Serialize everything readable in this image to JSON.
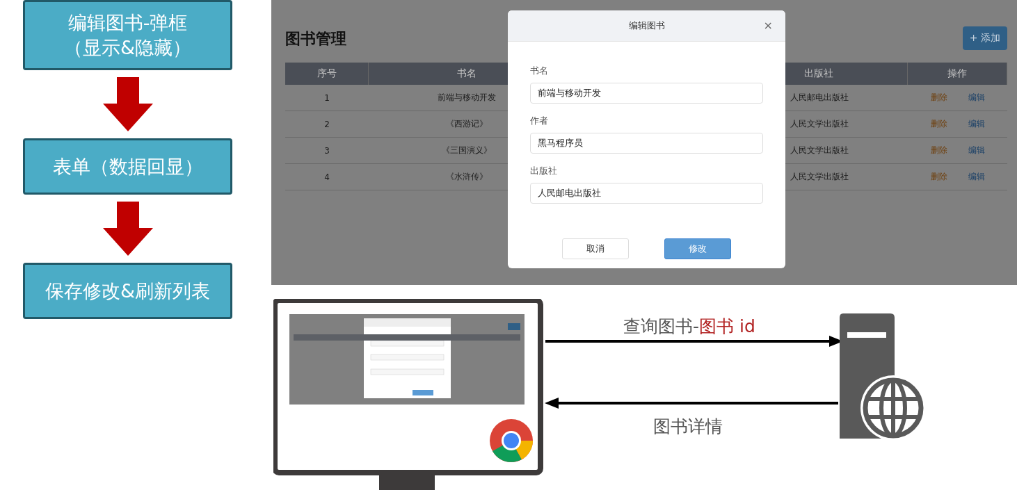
{
  "flow_steps": [
    {
      "lines": [
        "编辑图书-弹框",
        "（显示&隐藏）"
      ]
    },
    {
      "lines": [
        "表单（数据回显）"
      ]
    },
    {
      "lines": [
        "保存修改&刷新列表"
      ]
    }
  ],
  "screenshot": {
    "page_title": "图书管理",
    "add_button": "+ 添加",
    "columns": [
      "序号",
      "书名",
      "出版社",
      "操作"
    ],
    "rows": [
      {
        "index": "1",
        "name": "前端与移动开发",
        "publisher": "人民邮电出版社",
        "delete": "删除",
        "edit": "编辑"
      },
      {
        "index": "2",
        "name": "《西游记》",
        "publisher": "人民文学出版社",
        "delete": "删除",
        "edit": "编辑"
      },
      {
        "index": "3",
        "name": "《三国演义》",
        "publisher": "人民文学出版社",
        "delete": "删除",
        "edit": "编辑"
      },
      {
        "index": "4",
        "name": "《水浒传》",
        "publisher": "人民文学出版社",
        "delete": "删除",
        "edit": "编辑"
      }
    ],
    "dialog": {
      "title": "编辑图书",
      "close": "×",
      "fields": [
        {
          "label": "书名",
          "value": "前端与移动开发"
        },
        {
          "label": "作者",
          "value": "黑马程序员"
        },
        {
          "label": "出版社",
          "value": "人民邮电出版社"
        }
      ],
      "cancel": "取消",
      "confirm": "修改"
    }
  },
  "diagram": {
    "request_label": {
      "text": "查询图书-",
      "highlight": "图书 id"
    },
    "response_label": "图书详情"
  }
}
